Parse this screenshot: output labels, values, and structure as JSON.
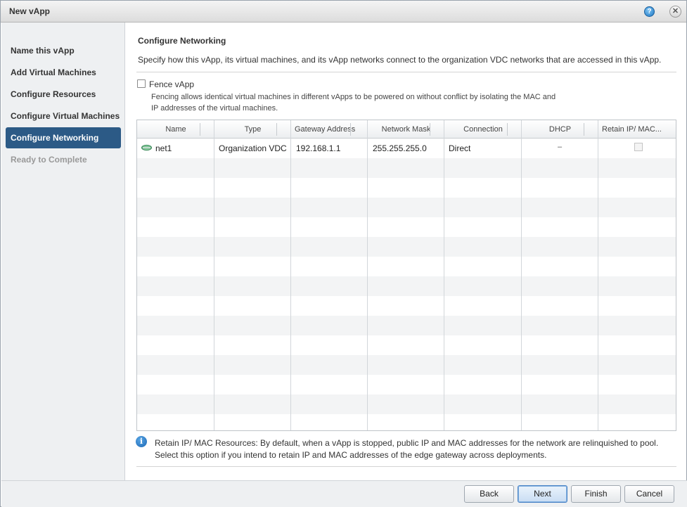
{
  "window": {
    "title": "New vApp",
    "help_icon": "?",
    "close_icon": "✕"
  },
  "sidebar": {
    "items": [
      {
        "label": "Name this vApp",
        "state": "normal"
      },
      {
        "label": "Add Virtual Machines",
        "state": "normal"
      },
      {
        "label": "Configure Resources",
        "state": "normal"
      },
      {
        "label": "Configure Virtual Machines",
        "state": "normal"
      },
      {
        "label": "Configure Networking",
        "state": "active"
      },
      {
        "label": "Ready to Complete",
        "state": "disabled"
      }
    ]
  },
  "main": {
    "heading": "Configure Networking",
    "description": "Specify how this vApp, its virtual machines, and its vApp networks connect to the organization VDC networks that are accessed in this vApp.",
    "fence": {
      "label": "Fence vApp",
      "checked": false,
      "help_line1": "Fencing allows identical virtual machines in different vApps to be powered on without conflict by isolating the MAC and",
      "help_line2": "IP addresses of the virtual machines."
    },
    "table": {
      "columns": [
        "Name",
        "Type",
        "Gateway Address",
        "Network Mask",
        "Connection",
        "DHCP",
        "Retain IP/ MAC..."
      ],
      "rows": [
        {
          "name": "net1",
          "type": "Organization VDC",
          "gateway": "192.168.1.1",
          "mask": "255.255.255.0",
          "connection": "Direct",
          "dhcp": "–",
          "retain": false
        }
      ]
    },
    "info": {
      "line1": "Retain IP/ MAC Resources: By default, when a vApp is stopped, public IP and MAC addresses for the network are relinquished to pool.",
      "line2": "Select this option if you intend to retain IP and MAC addresses of the edge gateway across deployments."
    }
  },
  "footer": {
    "back": "Back",
    "next": "Next",
    "finish": "Finish",
    "cancel": "Cancel"
  },
  "colors": {
    "active_nav": "#2c5a86",
    "sidebar_bg": "#eef0f2",
    "accent_button": "#c9ddf3"
  }
}
